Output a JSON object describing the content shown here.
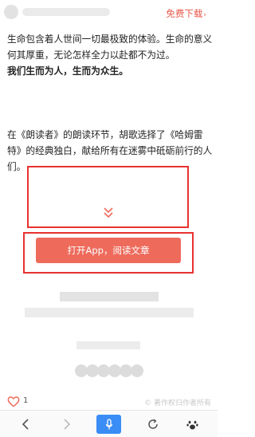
{
  "header": {
    "download_label": "免费下载",
    "download_caret": "›"
  },
  "article": {
    "paragraph_1": "生命包含着人世间一切最极致的体验。生命的意义何其厚重，无论怎样全力以赴都不为过。",
    "paragraph_2": "我们生而为人，生而为众生。",
    "paragraph_3": "在《朗读者》的朗读环节，胡歌选择了《哈姆雷特》的经典独白，献给所有在迷雾中砥砺前行的人们。"
  },
  "cta": {
    "open_app_label": "打开App，阅读文章"
  },
  "footer": {
    "like_count": "1",
    "copyright": "© 著作权归作者所有"
  },
  "colors": {
    "accent": "#ee6b5c",
    "highlight_border": "#e8322f",
    "mic_blue": "#3a8df5"
  },
  "icons": [
    "chevron-double-down-icon",
    "heart-icon",
    "back-icon",
    "forward-icon",
    "mic-icon",
    "refresh-icon",
    "paw-icon"
  ]
}
